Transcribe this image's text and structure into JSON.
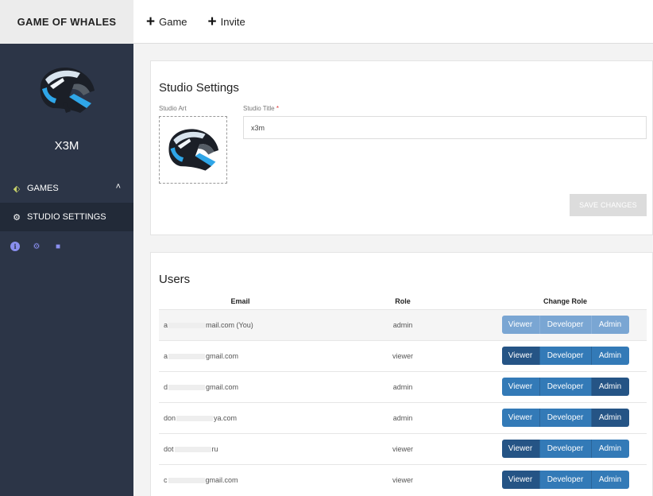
{
  "brand": "GAME OF WHALES",
  "topbar": {
    "game_label": "Game",
    "invite_label": "Invite"
  },
  "sidebar": {
    "studio_name": "X3M",
    "games_label": "GAMES",
    "studio_settings_label": "STUDIO SETTINGS"
  },
  "settings": {
    "heading": "Studio Settings",
    "art_label": "Studio Art",
    "title_label": "Studio Title",
    "title_required": "*",
    "title_value": "x3m",
    "save_label": "SAVE CHANGES"
  },
  "users": {
    "heading": "Users",
    "columns": [
      "Email",
      "Role",
      "Change Role"
    ],
    "role_buttons": [
      "Viewer",
      "Developer",
      "Admin"
    ],
    "rows": [
      {
        "email_start": "a",
        "email_end": "mail.com (You)",
        "role": "admin",
        "active": "none"
      },
      {
        "email_start": "a",
        "email_end": "gmail.com",
        "role": "viewer",
        "active": "viewer"
      },
      {
        "email_start": "d",
        "email_end": "gmail.com",
        "role": "admin",
        "active": "admin"
      },
      {
        "email_start": "don",
        "email_end": "ya.com",
        "role": "admin",
        "active": "admin"
      },
      {
        "email_start": "dot",
        "email_end": "ru",
        "role": "viewer",
        "active": "viewer"
      },
      {
        "email_start": "c",
        "email_end": "gmail.com",
        "role": "viewer",
        "active": "viewer"
      }
    ]
  },
  "colors": {
    "sidebar_bg": "#2c3547",
    "button_blue": "#337ab7",
    "button_active": "#255485"
  }
}
